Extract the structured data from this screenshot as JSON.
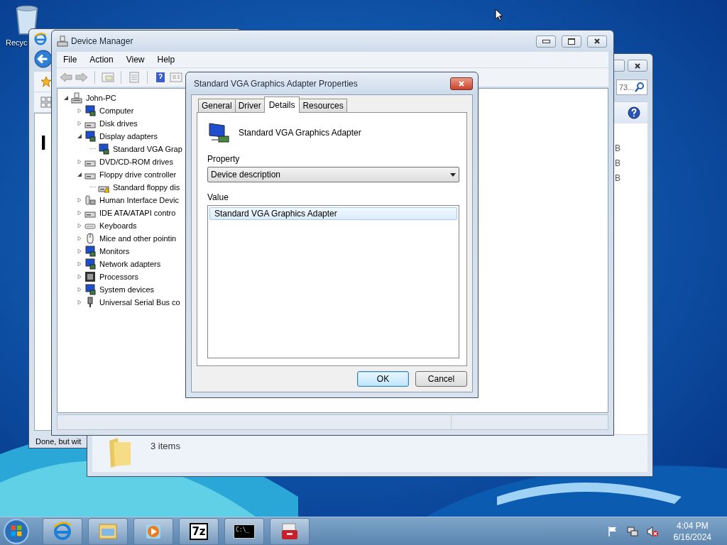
{
  "desktop": {
    "icons": [
      {
        "label": "Recyc"
      }
    ]
  },
  "browser_window": {
    "heading": "I",
    "status": "Done, but wit"
  },
  "explorer_window": {
    "search": {
      "value": "73..."
    },
    "file_sizes": [
      "B",
      "B",
      "B"
    ],
    "status": "3 items"
  },
  "device_manager": {
    "title": "Device Manager",
    "menu": [
      "File",
      "Action",
      "View",
      "Help"
    ],
    "tree": {
      "label": "John-PC",
      "kind": "pc",
      "expanded": true,
      "children": [
        {
          "label": "Computer",
          "kind": "screen",
          "expanded": false
        },
        {
          "label": "Disk drives",
          "kind": "drive",
          "expanded": false
        },
        {
          "label": "Display adapters",
          "kind": "screen",
          "expanded": true,
          "children": [
            {
              "label": "Standard VGA Grap",
              "kind": "screen",
              "warning": false
            }
          ]
        },
        {
          "label": "DVD/CD-ROM drives",
          "kind": "drive",
          "expanded": false
        },
        {
          "label": "Floppy drive controller",
          "kind": "drive",
          "expanded": true,
          "children": [
            {
              "label": "Standard floppy dis",
              "kind": "drive",
              "warning": true
            }
          ]
        },
        {
          "label": "Human Interface Devic",
          "kind": "gadget",
          "expanded": false
        },
        {
          "label": "IDE ATA/ATAPI contro",
          "kind": "drive",
          "expanded": false
        },
        {
          "label": "Keyboards",
          "kind": "keyboard",
          "expanded": false
        },
        {
          "label": "Mice and other pointin",
          "kind": "mouse",
          "expanded": false
        },
        {
          "label": "Monitors",
          "kind": "screen",
          "expanded": false
        },
        {
          "label": "Network adapters",
          "kind": "screen",
          "expanded": false
        },
        {
          "label": "Processors",
          "kind": "chip",
          "expanded": false
        },
        {
          "label": "System devices",
          "kind": "screen",
          "expanded": false
        },
        {
          "label": "Universal Serial Bus co",
          "kind": "plug",
          "expanded": false
        }
      ]
    }
  },
  "properties_dialog": {
    "title": "Standard VGA Graphics Adapter Properties",
    "tabs": [
      {
        "label": "General",
        "selected": false
      },
      {
        "label": "Driver",
        "selected": false
      },
      {
        "label": "Details",
        "selected": true
      },
      {
        "label": "Resources",
        "selected": false
      }
    ],
    "device_name": "Standard VGA Graphics Adapter",
    "property": {
      "label": "Property",
      "value": "Device description"
    },
    "value": {
      "label": "Value",
      "items": [
        {
          "text": "Standard VGA Graphics Adapter",
          "selected": true
        }
      ]
    },
    "buttons": [
      {
        "label": "OK",
        "default": true
      },
      {
        "label": "Cancel",
        "default": false
      }
    ]
  },
  "taskbar": {
    "apps": [
      {
        "kind": "browser"
      },
      {
        "kind": "folder"
      },
      {
        "kind": "media"
      },
      {
        "kind": "archiver",
        "label": "7z"
      },
      {
        "kind": "console",
        "label": "C:\\_"
      },
      {
        "kind": "toolbox"
      }
    ],
    "clock": {
      "time": "4:04 PM",
      "date": "6/16/2024"
    }
  }
}
